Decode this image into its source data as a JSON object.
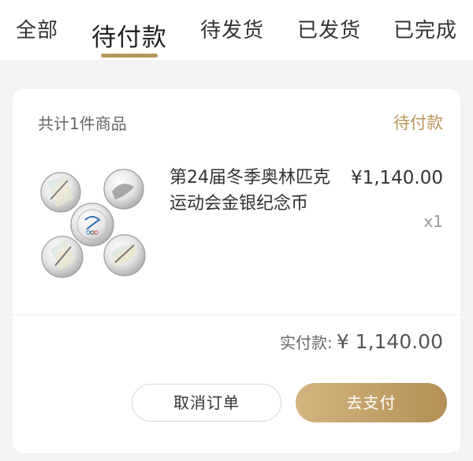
{
  "tabs": [
    {
      "label": "全部"
    },
    {
      "label": "待付款"
    },
    {
      "label": "待发货"
    },
    {
      "label": "已发货"
    },
    {
      "label": "已完成"
    }
  ],
  "active_tab": "待付款",
  "order": {
    "item_count_text": "共计1件商品",
    "status": "待付款",
    "product": {
      "name": "第24届冬季奥林匹克运动会金银纪念币",
      "price": "¥1,140.00",
      "quantity": "x1"
    },
    "total_label": "实付款:",
    "total_value": "¥ 1,140.00",
    "cancel_label": "取消订单",
    "pay_label": "去支付"
  },
  "colors": {
    "accent_gold": "#b9955a",
    "pay_button_gradient": [
      "#d3b57f",
      "#b38f55"
    ]
  }
}
